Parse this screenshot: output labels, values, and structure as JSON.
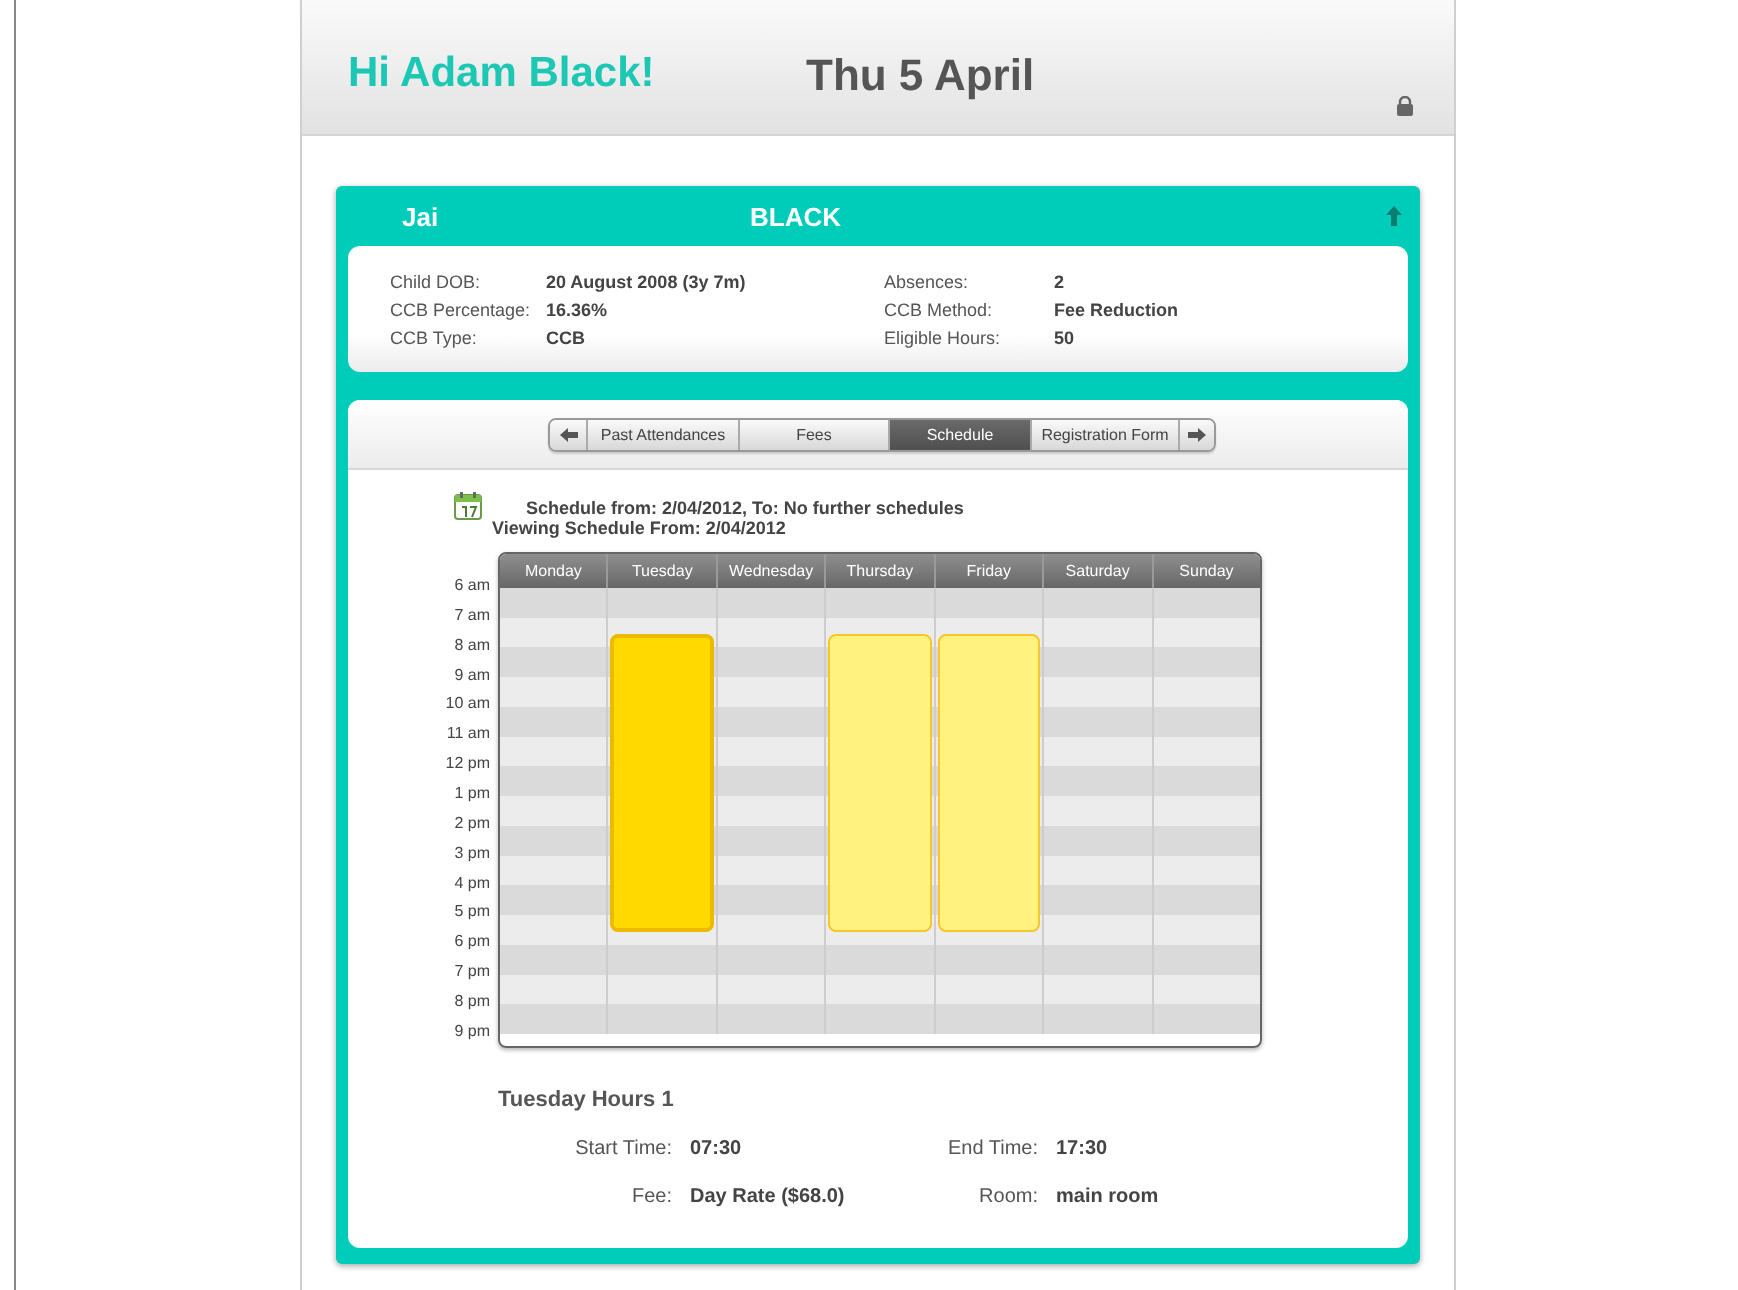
{
  "header": {
    "greeting": "Hi Adam Black!",
    "date": "Thu 5 April"
  },
  "child": {
    "first_name": "Jai",
    "last_name": "BLACK"
  },
  "info": [
    {
      "label": "Child DOB:",
      "value": "20 August 2008 (3y 7m)"
    },
    {
      "label": "Absences:",
      "value": "2"
    },
    {
      "label": "CCB Percentage:",
      "value": "16.36%"
    },
    {
      "label": "CCB Method:",
      "value": "Fee Reduction"
    },
    {
      "label": "CCB Type:",
      "value": "CCB"
    },
    {
      "label": "Eligible Hours:",
      "value": "50"
    }
  ],
  "tabs": [
    {
      "label": "Past Attendances",
      "selected": false
    },
    {
      "label": "Fees",
      "selected": false
    },
    {
      "label": "Schedule",
      "selected": true
    },
    {
      "label": "Registration Form",
      "selected": false
    }
  ],
  "schedule": {
    "range": "Schedule from: 2/04/2012, To: No further schedules",
    "viewing": "Viewing Schedule From: 2/04/2012"
  },
  "calendar": {
    "times": [
      "6 am",
      "7 am",
      "8 am",
      "9 am",
      "10 am",
      "11 am",
      "12 pm",
      "1 pm",
      "2 pm",
      "3 pm",
      "4 pm",
      "5 pm",
      "6 pm",
      "7 pm",
      "8 pm",
      "9 pm"
    ],
    "days": [
      {
        "label": "Monday"
      },
      {
        "label": "Tuesday",
        "block": {
          "selected": true
        }
      },
      {
        "label": "Wednesday"
      },
      {
        "label": "Thursday",
        "block": {
          "selected": false
        }
      },
      {
        "label": "Friday",
        "block": {
          "selected": false
        }
      },
      {
        "label": "Saturday"
      },
      {
        "label": "Sunday"
      }
    ]
  },
  "details": {
    "title": "Tuesday Hours 1",
    "fields": [
      {
        "label": "Start Time:",
        "value": "07:30"
      },
      {
        "label": "End Time:",
        "value": "17:30"
      },
      {
        "label": "Fee:",
        "value": "Day Rate ($68.0)"
      },
      {
        "label": "Room:",
        "value": "main room"
      }
    ]
  }
}
